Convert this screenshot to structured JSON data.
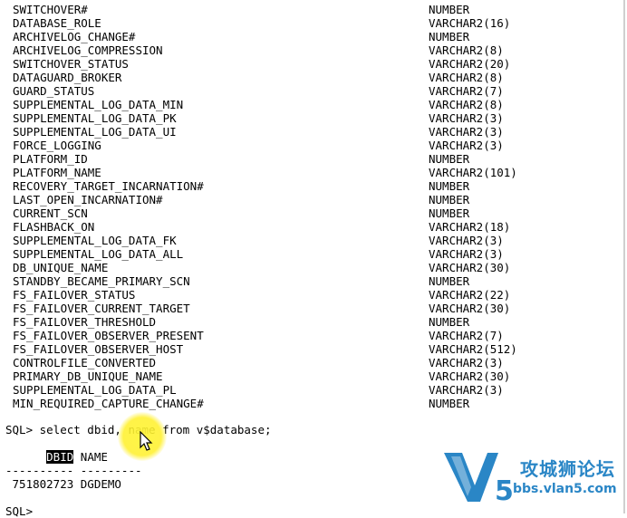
{
  "columns": [
    {
      "name": "SWITCHOVER#",
      "type": "NUMBER"
    },
    {
      "name": "DATABASE_ROLE",
      "type": "VARCHAR2(16)"
    },
    {
      "name": "ARCHIVELOG_CHANGE#",
      "type": "NUMBER"
    },
    {
      "name": "ARCHIVELOG_COMPRESSION",
      "type": "VARCHAR2(8)"
    },
    {
      "name": "SWITCHOVER_STATUS",
      "type": "VARCHAR2(20)"
    },
    {
      "name": "DATAGUARD_BROKER",
      "type": "VARCHAR2(8)"
    },
    {
      "name": "GUARD_STATUS",
      "type": "VARCHAR2(7)"
    },
    {
      "name": "SUPPLEMENTAL_LOG_DATA_MIN",
      "type": "VARCHAR2(8)"
    },
    {
      "name": "SUPPLEMENTAL_LOG_DATA_PK",
      "type": "VARCHAR2(3)"
    },
    {
      "name": "SUPPLEMENTAL_LOG_DATA_UI",
      "type": "VARCHAR2(3)"
    },
    {
      "name": "FORCE_LOGGING",
      "type": "VARCHAR2(3)"
    },
    {
      "name": "PLATFORM_ID",
      "type": "NUMBER"
    },
    {
      "name": "PLATFORM_NAME",
      "type": "VARCHAR2(101)"
    },
    {
      "name": "RECOVERY_TARGET_INCARNATION#",
      "type": "NUMBER"
    },
    {
      "name": "LAST_OPEN_INCARNATION#",
      "type": "NUMBER"
    },
    {
      "name": "CURRENT_SCN",
      "type": "NUMBER"
    },
    {
      "name": "FLASHBACK_ON",
      "type": "VARCHAR2(18)"
    },
    {
      "name": "SUPPLEMENTAL_LOG_DATA_FK",
      "type": "VARCHAR2(3)"
    },
    {
      "name": "SUPPLEMENTAL_LOG_DATA_ALL",
      "type": "VARCHAR2(3)"
    },
    {
      "name": "DB_UNIQUE_NAME",
      "type": "VARCHAR2(30)"
    },
    {
      "name": "STANDBY_BECAME_PRIMARY_SCN",
      "type": "NUMBER"
    },
    {
      "name": "FS_FAILOVER_STATUS",
      "type": "VARCHAR2(22)"
    },
    {
      "name": "FS_FAILOVER_CURRENT_TARGET",
      "type": "VARCHAR2(30)"
    },
    {
      "name": "FS_FAILOVER_THRESHOLD",
      "type": "NUMBER"
    },
    {
      "name": "FS_FAILOVER_OBSERVER_PRESENT",
      "type": "VARCHAR2(7)"
    },
    {
      "name": "FS_FAILOVER_OBSERVER_HOST",
      "type": "VARCHAR2(512)"
    },
    {
      "name": "CONTROLFILE_CONVERTED",
      "type": "VARCHAR2(3)"
    },
    {
      "name": "PRIMARY_DB_UNIQUE_NAME",
      "type": "VARCHAR2(30)"
    },
    {
      "name": "SUPPLEMENTAL_LOG_DATA_PL",
      "type": "VARCHAR2(3)"
    },
    {
      "name": "MIN_REQUIRED_CAPTURE_CHANGE#",
      "type": "NUMBER"
    }
  ],
  "query": {
    "command": "SQL> select dbid, name from v$database;",
    "header_dbid": "DBID",
    "header_name": " NAME",
    "separator": "---------- ---------",
    "result_row": " 751802723 DGDEMO",
    "next_prompt": "SQL>"
  },
  "watermark": {
    "logo_letter": "V",
    "logo_digit": "5",
    "title": "攻城狮论坛",
    "url": "bbs.vlan5.com",
    "color": "#2a86c6"
  }
}
